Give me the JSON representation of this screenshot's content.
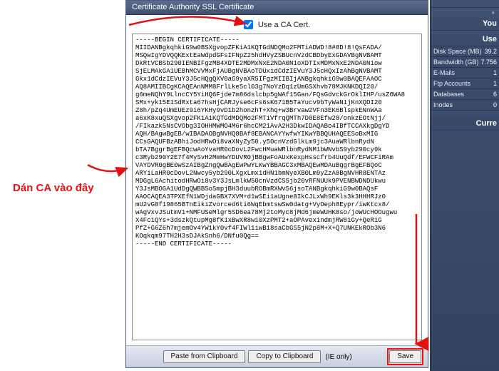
{
  "panel": {
    "title": "Certificate Authority SSL Certificate",
    "use_ca_label": "Use a CA Cert.",
    "use_ca_checked": true,
    "certificate_text": "-----BEGIN CERTIFICATE-----\nMIIDANBgkqhkiG9w0BSXgvopZFKiA1KQTGdNDQMo2FMTiADWD!8#8D!8!QsFADA/\nMSQwIgYDVQQKExtEaWdpdGFsIFNpZ25hdHVyZSBUcnVzdCBDbyExGDAVBgNVBAMT\nDkRtVCBSb290IENBIFgzMB4XDTE2MDMxNxE2NDA0N1oXDTIxMDMxNxE2NDA0N1ow\nSjELMAkGA1UEBhMCVVMxFjAUBgNVBAoTDUxidCdzIEVuY3J5cHQxIzAhBgNVBAMT\nGkx1dCdzIEVuY3J5cHQgQXV0aG9yaXR5IFgzMIIBIjANBgkqhkiG9w0BAQEFAAOC\nAQ8AMIIBCgKCAQEAnNMM8FrlLke5cl03g7NoYzDq1zUmGSXhvb78MJKNKDQI20/\ng6meNQhY9LlncCY5YiHQ6Fjde7m86dslcbp5gWAf15Gan/FQsGdvckGrOklIHP/usZ6WA8\nSMx+yk15E1SdRxta67hsHjCARJyse6cFs6sK671B5TaYucv9bTyWaN1jKnXQDI20\nZ8h/pZq4UmEUEz9i6YKHy9vD1b2honzhT+Xhq+w3Brvaw2VFn3EK6BlspkENnWAa\na6xK8xuQSXgvop2FKiA1KQTGdMDQMo2FMTiVfrqQMTh7D8E8Efw28/onkzEOtNjj/\n/FIkazk5NsCVObg3IOHHMWMO4M6r6hcCM21AvA2H3DkwIDAQABo4IBfTCCAXkgDgYD\nAQH/BAgwBgEB/wIBADAOBgNVHQ8BAf8EBANCAYYwfwYIKwYBBQUHAQEESoBxMIG\nCCsGAQUFBzABhiJodHRwOi8vaXNyZy50.y50cnVzdGlkLm9jc3AuaWRlbnRydN\nbTA7BggrBgEFBQcwAoYvaHR0cDovL2FwcHMuaWRlbnRydNM1bWNvbS9yb290cy9k\nc3Ryb290Y2E7f4MySvH2MmHwYDUVR0jBBgwFoAUxKexpHsscfrb4UuQdf/EFWCFiRAm\nVAYDVR0gBE0wSzAIBgZngQwBAgEwPwYLKwYBBAGC3xMBAQEwMDAuBggrBgEFBQoC\nARYiLaHR0cDovL2Nwcy5yb290LXgxLmx1dHN1bmNyeXB0Lm9yZzA8BgNVHR8ENTAz\nMDGgL6AchitodHRwOi8v3Y3JsLmlkW50cnVzdCS5jb20vRFNUUk9PVENBWDNDUkwu\nY3JsMBOGA1UdDgQWBBSoSmpjBH3duubROBmRXWv56jsoTANBgkqhkiG9w0BAQsF\nAAOCAQEA3TPXEfN1WDjdaGBX7XVM+d1wSEi1aUgne8IkCJLxWh9EKls3k3HHHRJz0\nmU2vG8f19865BTnEikiZvorced6ti6WqEbmtswSw0datg+VyOeph8Eypr/iwKtcx8/\nwAgVxvJSutmV1+NMFUSeMlgr5SD6ea78Mj2toMyc8jMd6jmeWUHK8so/joWUcHOOugwu\nX4Fc1QYs+3dszkQtupMg8fK1xBwXR8w10XzPMT2+aOPAvexindmjRW81Gy+QeR1G\nPfZ+G6Z6h7mjemOv4YW1kY0vf4FIWl1iwB18saCbGS5jN2p8M+X+Q7UNKEkROb3N6\nKOqkqm97TH2H3sDJAkSnh6/DNfu0Qg==\n-----END CERTIFICATE-----",
    "buttons": {
      "paste": "Paste from Clipboard",
      "copy": "Copy to Clipboard",
      "ie_only": "(IE only)",
      "save": "Save"
    }
  },
  "sidebar": {
    "crumb": "» ",
    "section_your": "You",
    "section_used": "Use",
    "section_current": "Curre",
    "rows": [
      {
        "label": "Disk Space (MB)",
        "value": "39.2"
      },
      {
        "label": "Bandwidth (GB)",
        "value": "7.756"
      },
      {
        "label": "E-Mails",
        "value": "1"
      },
      {
        "label": "Ftp Accounts",
        "value": "1"
      },
      {
        "label": "Databases",
        "value": "6"
      },
      {
        "label": "Inodes",
        "value": "0"
      }
    ]
  },
  "annotation": {
    "text": "Dán CA vào đây"
  }
}
